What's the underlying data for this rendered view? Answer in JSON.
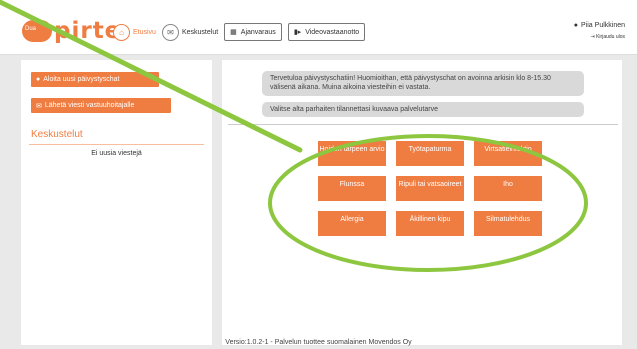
{
  "header": {
    "logo_badge": "Dua",
    "logo_text": "pirte",
    "nav": {
      "home": "Etusivu",
      "messages": "Keskustelut",
      "booking": "Ajanvaraus",
      "video": "Videovastaanotto"
    },
    "user_name": "Piia Pulkkinen",
    "logout": "Kirjaudu ulos"
  },
  "sidebar": {
    "start_chat": "Aloita uusi päivystyschat",
    "send_message": "Lähetä viesti vastuuhoitajalle",
    "section_title": "Keskustelut",
    "empty_text": "Ei uusia viestejä"
  },
  "main": {
    "welcome": "Tervetuloa päivystyschatiin! Huomioithan, että päivystyschat on avoinna arkisin klo 8-15.30 välisenä aikana. Muina aikoina viesteihin ei vastata.",
    "prompt": "Valitse alta parhaiten tilannettasi kuvaava palvelutarve",
    "tiles": [
      "Hoidon tarpeen arvio",
      "Työtapaturma",
      "Virtsatieinfektio",
      "Flunssa",
      "Ripuli tai vatsaoireet",
      "Iho",
      "Allergia",
      "Äkillinen kipu",
      "Silmatulehdus"
    ]
  },
  "footer": "Versio:1.0.2-1   -   Palvelun tuottee suomalainen Movendos Oy",
  "colors": {
    "accent": "#ef7d42",
    "annotation": "#8dc63f"
  }
}
